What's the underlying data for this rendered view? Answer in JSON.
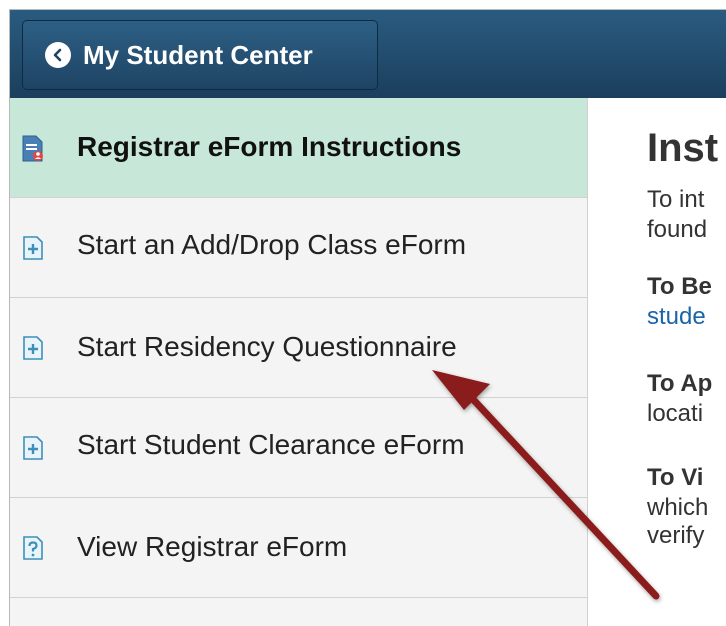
{
  "header": {
    "back_button_label": "My Student Center"
  },
  "sidebar": {
    "items": [
      {
        "label": "Registrar eForm Instructions",
        "icon": "document-user-icon",
        "active": true
      },
      {
        "label": "Start an Add/Drop Class eForm",
        "icon": "add-form-icon",
        "active": false
      },
      {
        "label": "Start Residency Questionnaire",
        "icon": "add-form-icon",
        "active": false
      },
      {
        "label": "Start Student Clearance eForm",
        "icon": "add-form-icon",
        "active": false
      },
      {
        "label": "View Registrar eForm",
        "icon": "view-form-icon",
        "active": false
      }
    ]
  },
  "content": {
    "title": "Inst",
    "lines": [
      "To int",
      "found",
      "To Be",
      "stude",
      "To Ap",
      "locati",
      "To Vi",
      "which",
      "verify"
    ]
  },
  "colors": {
    "header_bg": "#1f4a6d",
    "active_item_bg": "#c7e8d8",
    "link": "#1a64a8",
    "annotation_arrow": "#8b1a1a"
  }
}
